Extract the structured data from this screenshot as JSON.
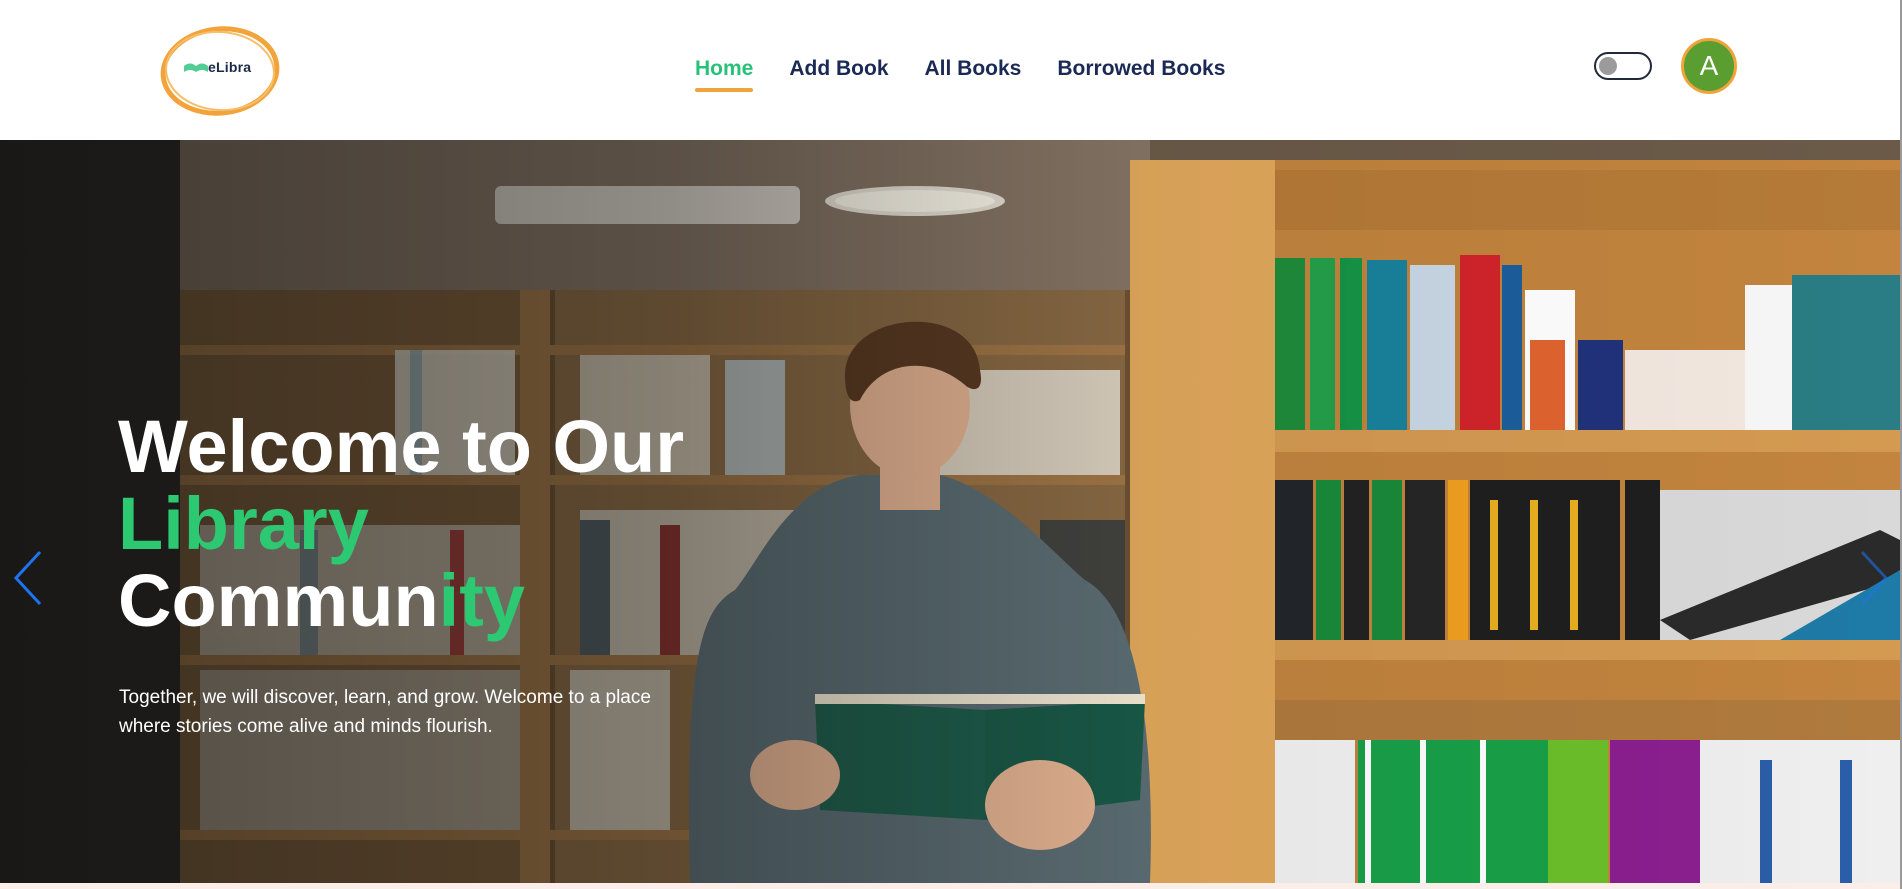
{
  "brand": {
    "logo_text": "eLibra",
    "accent": "#27c17a",
    "underline": "#f0a43c"
  },
  "nav": {
    "items": [
      {
        "label": "Home",
        "active": true
      },
      {
        "label": "Add Book",
        "active": false
      },
      {
        "label": "All Books",
        "active": false
      },
      {
        "label": "Borrowed Books",
        "active": false
      }
    ]
  },
  "theme_toggle": {
    "state": "off"
  },
  "user": {
    "avatar_initial": "A"
  },
  "hero": {
    "title_line1": "Welcome to Our",
    "title_line2": "Library",
    "title_line3_white": "Commun",
    "title_line3_green": "ity",
    "subtitle_line1": "Together, we will discover, learn, and grow. Welcome to a place",
    "subtitle_line2": "where stories come alive and minds flourish.",
    "prev_icon": "chevron-left-icon",
    "next_icon": "chevron-right-icon"
  }
}
